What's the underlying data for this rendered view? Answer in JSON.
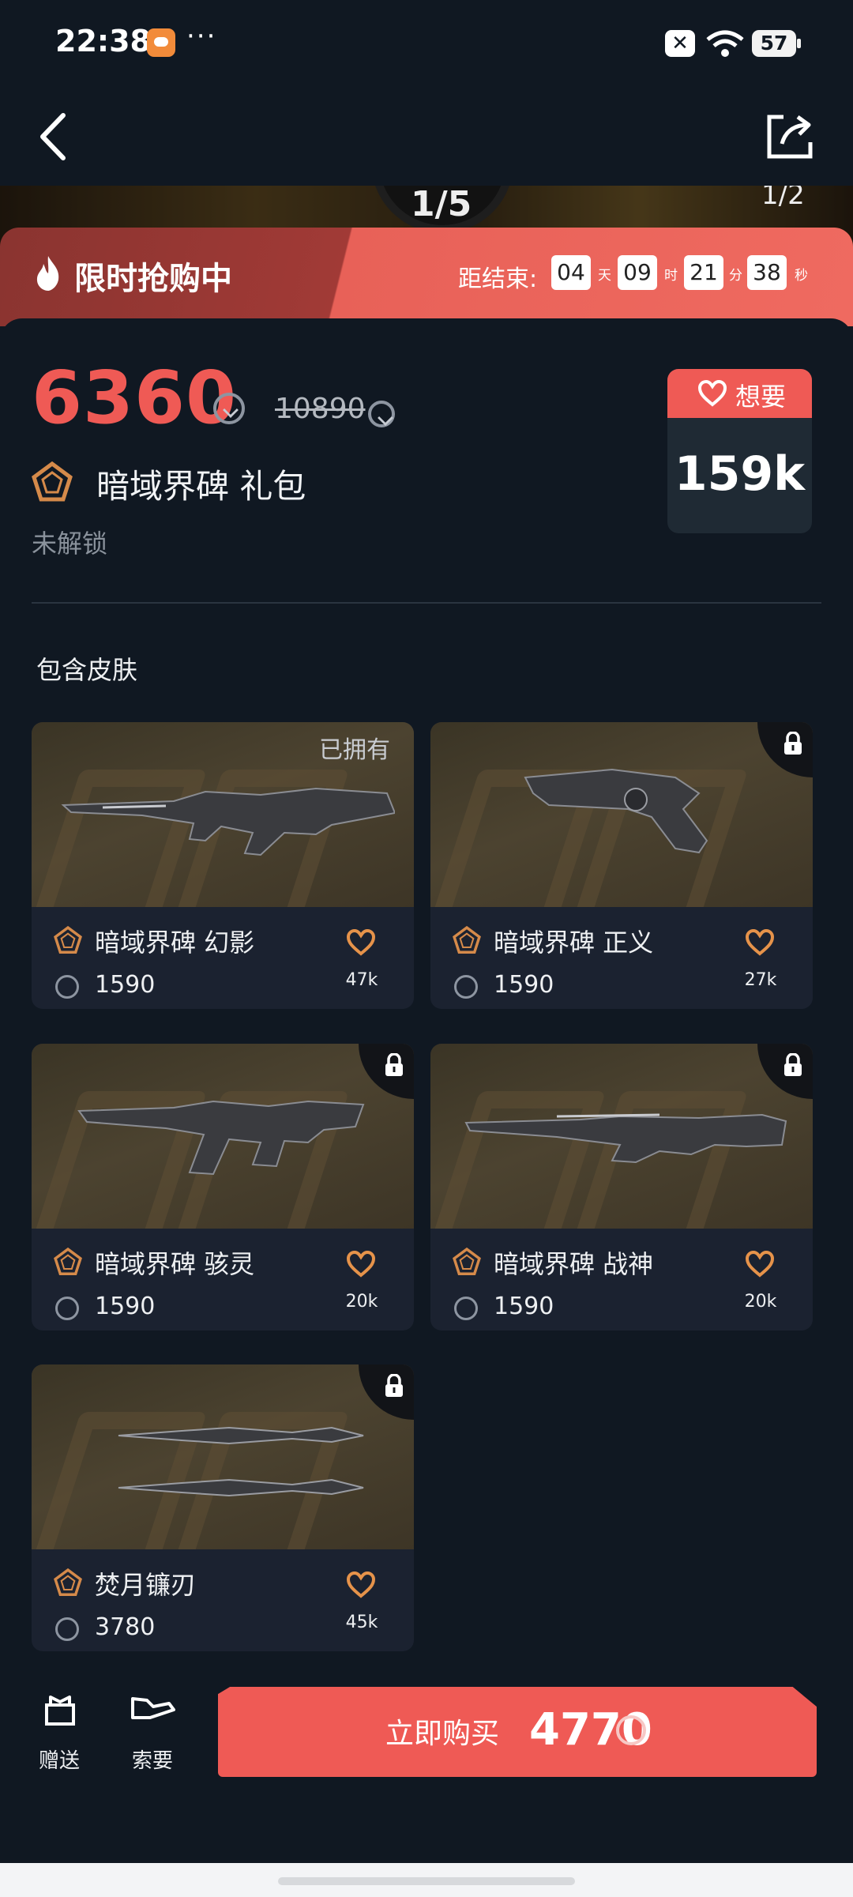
{
  "status_bar": {
    "time": "22:38",
    "dots": "···",
    "battery": "57"
  },
  "banner": {
    "left_number": "1/5",
    "page_indicator": "1/2"
  },
  "flash_sale": {
    "label": "限时抢购中",
    "countdown_label": "距结束:",
    "days": "04",
    "days_unit": "天",
    "hours": "09",
    "hours_unit": "时",
    "minutes": "21",
    "minutes_unit": "分",
    "seconds": "38",
    "seconds_unit": "秒"
  },
  "bundle": {
    "price": "6360",
    "original_price": "10890",
    "title": "暗域界碑 礼包",
    "status": "未解锁"
  },
  "want": {
    "label": "想要",
    "count": "159k"
  },
  "skins_section": {
    "title": "包含皮肤"
  },
  "skins": [
    {
      "name": "暗域界碑 幻影",
      "price": "1590",
      "likes": "47k",
      "owned_label": "已拥有"
    },
    {
      "name": "暗域界碑 正义",
      "price": "1590",
      "likes": "27k"
    },
    {
      "name": "暗域界碑 骇灵",
      "price": "1590",
      "likes": "20k"
    },
    {
      "name": "暗域界碑 战神",
      "price": "1590",
      "likes": "20k"
    },
    {
      "name": "焚月镰刃",
      "price": "3780",
      "likes": "45k"
    }
  ],
  "bottom_bar": {
    "gift_label": "赠送",
    "ask_label": "索要",
    "buy_label": "立即购买",
    "buy_price": "4770"
  },
  "colors": {
    "accent": "#ef5a55",
    "background": "#101822",
    "card": "#1b2230"
  }
}
